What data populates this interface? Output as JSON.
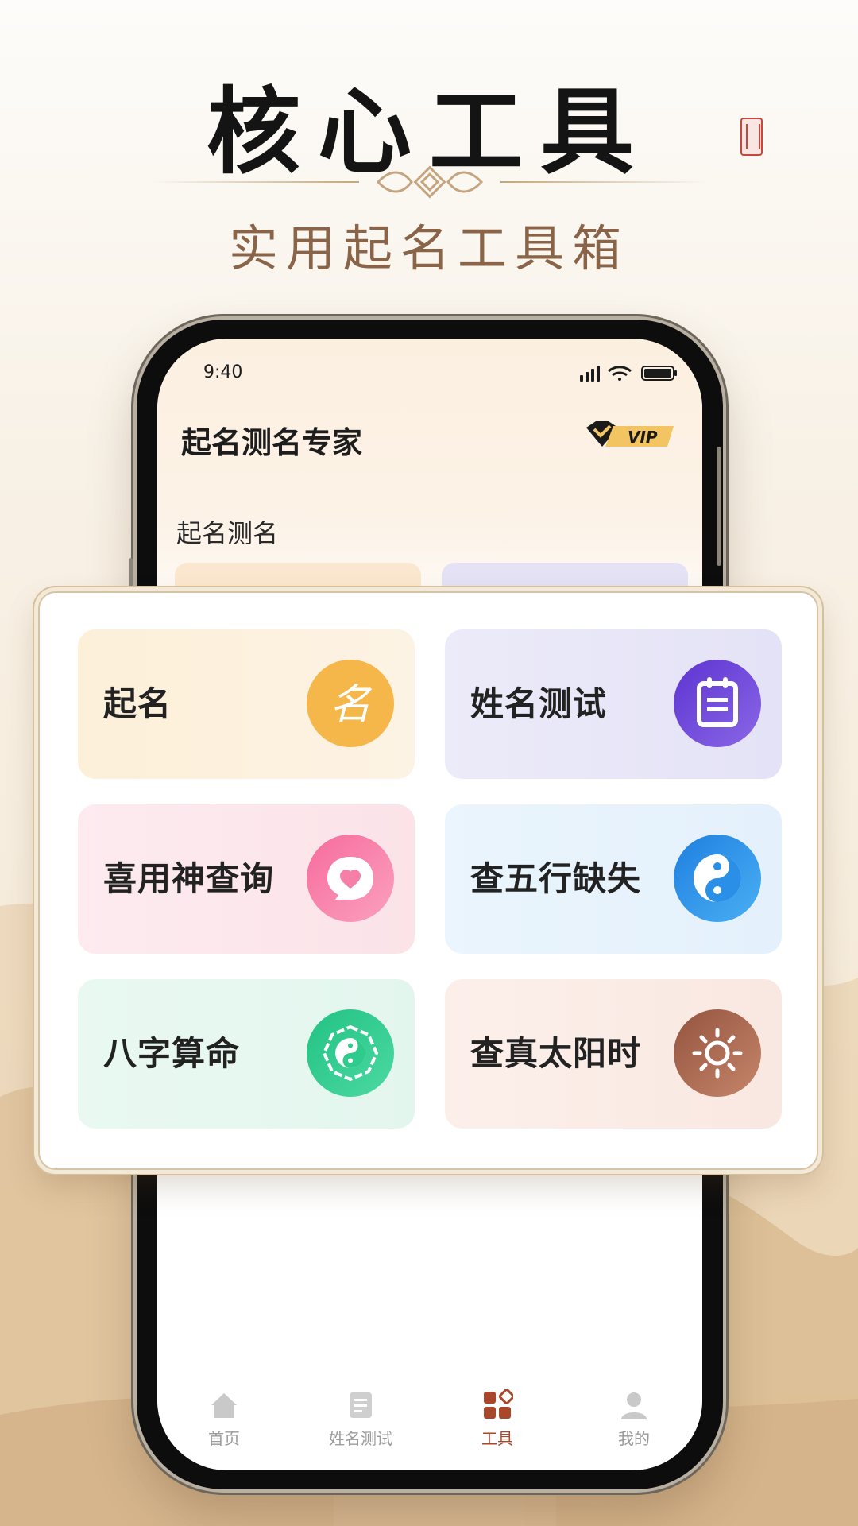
{
  "hero": {
    "title": "核心工具",
    "subtitle": "实用起名工具箱"
  },
  "status_bar": {
    "time": "9:40"
  },
  "app": {
    "title": "起名测名专家",
    "vip_label": "VIP",
    "section_title": "起名测名"
  },
  "tools": [
    {
      "label": "起名",
      "icon": "name-char-icon",
      "color": "#f5b64a",
      "bg": "#fdf0d9"
    },
    {
      "label": "姓名测试",
      "icon": "calendar-icon",
      "color": "#6a43d8",
      "bg": "#e9e7f8"
    },
    {
      "label": "喜用神查询",
      "icon": "heart-chat-icon",
      "color": "#f57fa7",
      "bg": "#fde7ec"
    },
    {
      "label": "查五行缺失",
      "icon": "yin-yang-icon",
      "color": "#2a8fe6",
      "bg": "#e6f2fc"
    },
    {
      "label": "八字算命",
      "icon": "bagua-icon",
      "color": "#2fcb8d",
      "bg": "#e6f8f0"
    },
    {
      "label": "查真太阳时",
      "icon": "sun-icon",
      "color": "#a8664f",
      "bg": "#fbece6"
    }
  ],
  "tabbar": {
    "items": [
      {
        "label": "首页",
        "icon": "home-icon",
        "active": false
      },
      {
        "label": "姓名测试",
        "icon": "name-test-icon",
        "active": false
      },
      {
        "label": "工具",
        "icon": "tools-icon",
        "active": true
      },
      {
        "label": "我的",
        "icon": "profile-icon",
        "active": false
      }
    ]
  },
  "colors": {
    "accent": "#a8472a",
    "panel_border": "#d8c4a4"
  }
}
